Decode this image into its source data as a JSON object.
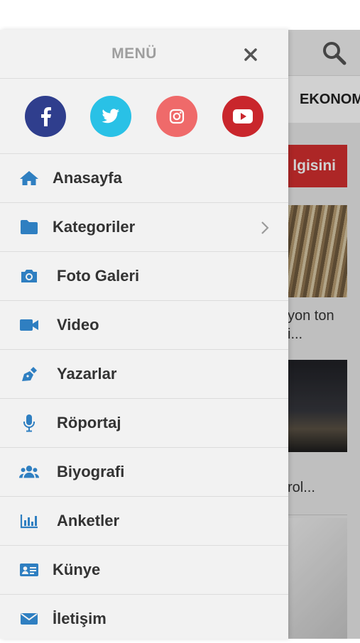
{
  "drawer": {
    "title": "MENÜ",
    "close_icon": "close-icon",
    "social": [
      {
        "name": "facebook-icon",
        "color": "#2f3e8d"
      },
      {
        "name": "twitter-icon",
        "color": "#29c1e6"
      },
      {
        "name": "instagram-icon",
        "color": "#ef6a6a"
      },
      {
        "name": "youtube-icon",
        "color": "#c9262c"
      }
    ],
    "items": [
      {
        "label": "Anasayfa",
        "icon": "home-icon"
      },
      {
        "label": "Kategoriler",
        "icon": "folder-icon",
        "has_submenu": true
      },
      {
        "label": "Foto Galeri",
        "icon": "camera-icon"
      },
      {
        "label": "Video",
        "icon": "video-camera-icon"
      },
      {
        "label": "Yazarlar",
        "icon": "pen-nib-icon"
      },
      {
        "label": "Röportaj",
        "icon": "microphone-icon"
      },
      {
        "label": "Biyografi",
        "icon": "users-icon"
      },
      {
        "label": "Anketler",
        "icon": "bar-chart-icon"
      },
      {
        "label": "Künye",
        "icon": "id-card-icon"
      },
      {
        "label": "İletişim",
        "icon": "envelope-icon"
      }
    ],
    "icon_color": "#2f7fc1"
  },
  "background_page": {
    "nav_tab": "EKONOM",
    "red_button": "lgisini",
    "headline_1": [
      "yon ton",
      "i..."
    ],
    "headline_2": [
      "",
      "rol..."
    ],
    "accent": "#d32f2f"
  }
}
